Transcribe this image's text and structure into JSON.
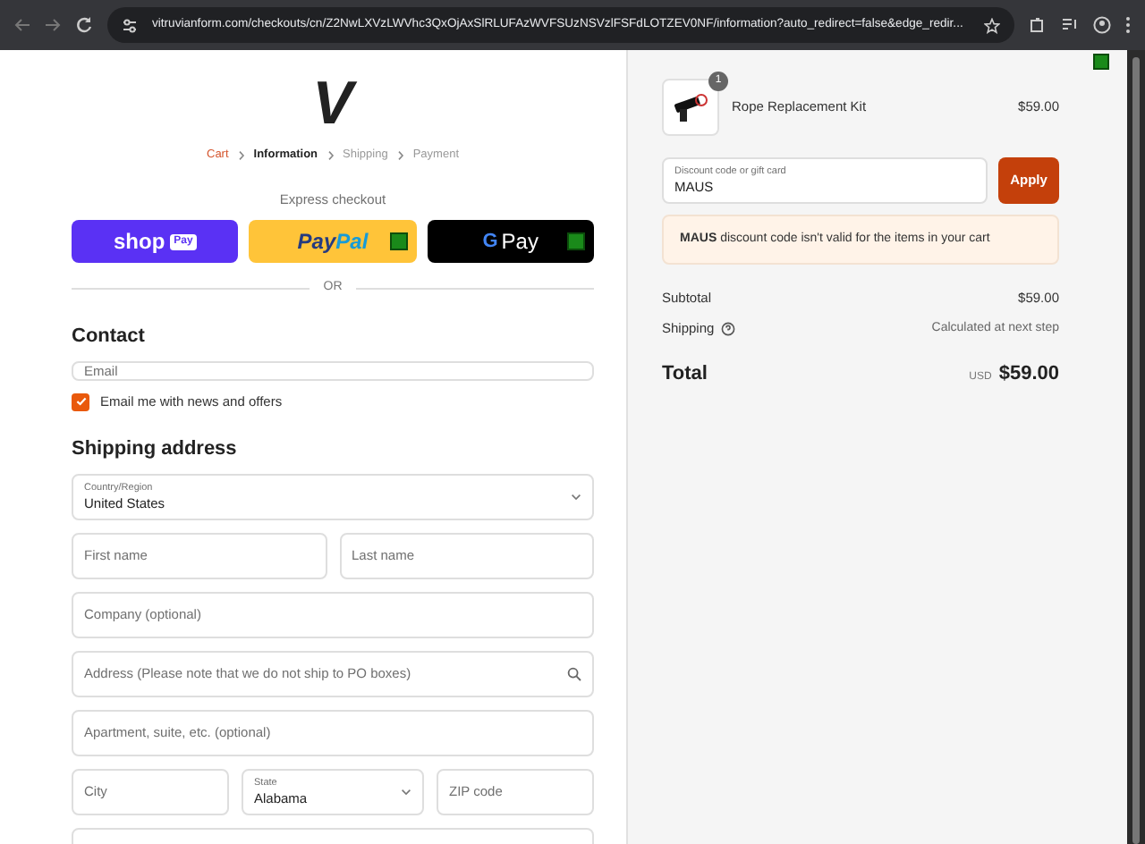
{
  "browser": {
    "url": "vitruvianform.com/checkouts/cn/Z2NwLXVzLWVhc3QxOjAxSlRLUFAzWVFSUzNSVzlFSFdLOTZEV0NF/information?auto_redirect=false&edge_redir..."
  },
  "logo": {
    "text": "V"
  },
  "breadcrumb": [
    {
      "label": "Cart",
      "kind": "link"
    },
    {
      "label": "Information",
      "kind": "current"
    },
    {
      "label": "Shipping",
      "kind": "upcoming"
    },
    {
      "label": "Payment",
      "kind": "upcoming"
    }
  ],
  "express": {
    "heading": "Express checkout",
    "buttons": [
      {
        "kind": "shop_pay",
        "text": "shop",
        "badge": "Pay"
      },
      {
        "kind": "paypal",
        "text": "Pay",
        "text_2": "Pal"
      },
      {
        "kind": "google_pay",
        "text": "G",
        "text_2": "Pay"
      }
    ],
    "divider": "OR"
  },
  "contact": {
    "heading": "Contact",
    "email": {
      "placeholder": "Email"
    },
    "newsletter": {
      "label": "Email me with news and offers",
      "checked": true
    }
  },
  "shipping": {
    "heading": "Shipping address",
    "rows": [
      [
        {
          "kind": "select",
          "label": "Country/Region",
          "value": "United States"
        }
      ],
      [
        {
          "kind": "text",
          "placeholder": "First name"
        },
        {
          "kind": "text",
          "placeholder": "Last name"
        }
      ],
      [
        {
          "kind": "text",
          "placeholder": "Company (optional)"
        }
      ],
      [
        {
          "kind": "search",
          "placeholder": "Address (Please note that we do not ship to PO boxes)"
        }
      ],
      [
        {
          "kind": "text",
          "placeholder": "Apartment, suite, etc. (optional)"
        }
      ],
      [
        {
          "kind": "text",
          "placeholder": "City"
        },
        {
          "kind": "select",
          "label": "State",
          "value": "Alabama"
        },
        {
          "kind": "text",
          "placeholder": "ZIP code"
        }
      ],
      [
        {
          "kind": "text"
        }
      ]
    ]
  },
  "order": {
    "item": {
      "name": "Rope Replacement Kit",
      "price": "$59.00",
      "quantity": "1"
    },
    "discount": {
      "label": "Discount code or gift card",
      "value": "MAUS",
      "button": "Apply"
    },
    "alert": "**MAUS** discount code isn't valid for the items in your cart",
    "subtotal": {
      "label": "Subtotal",
      "value": "$59.00"
    },
    "shipping": {
      "label": "Shipping",
      "value": "Calculated at next step"
    },
    "total": {
      "label": "Total",
      "currency": "USD",
      "value": "$59.00"
    }
  }
}
